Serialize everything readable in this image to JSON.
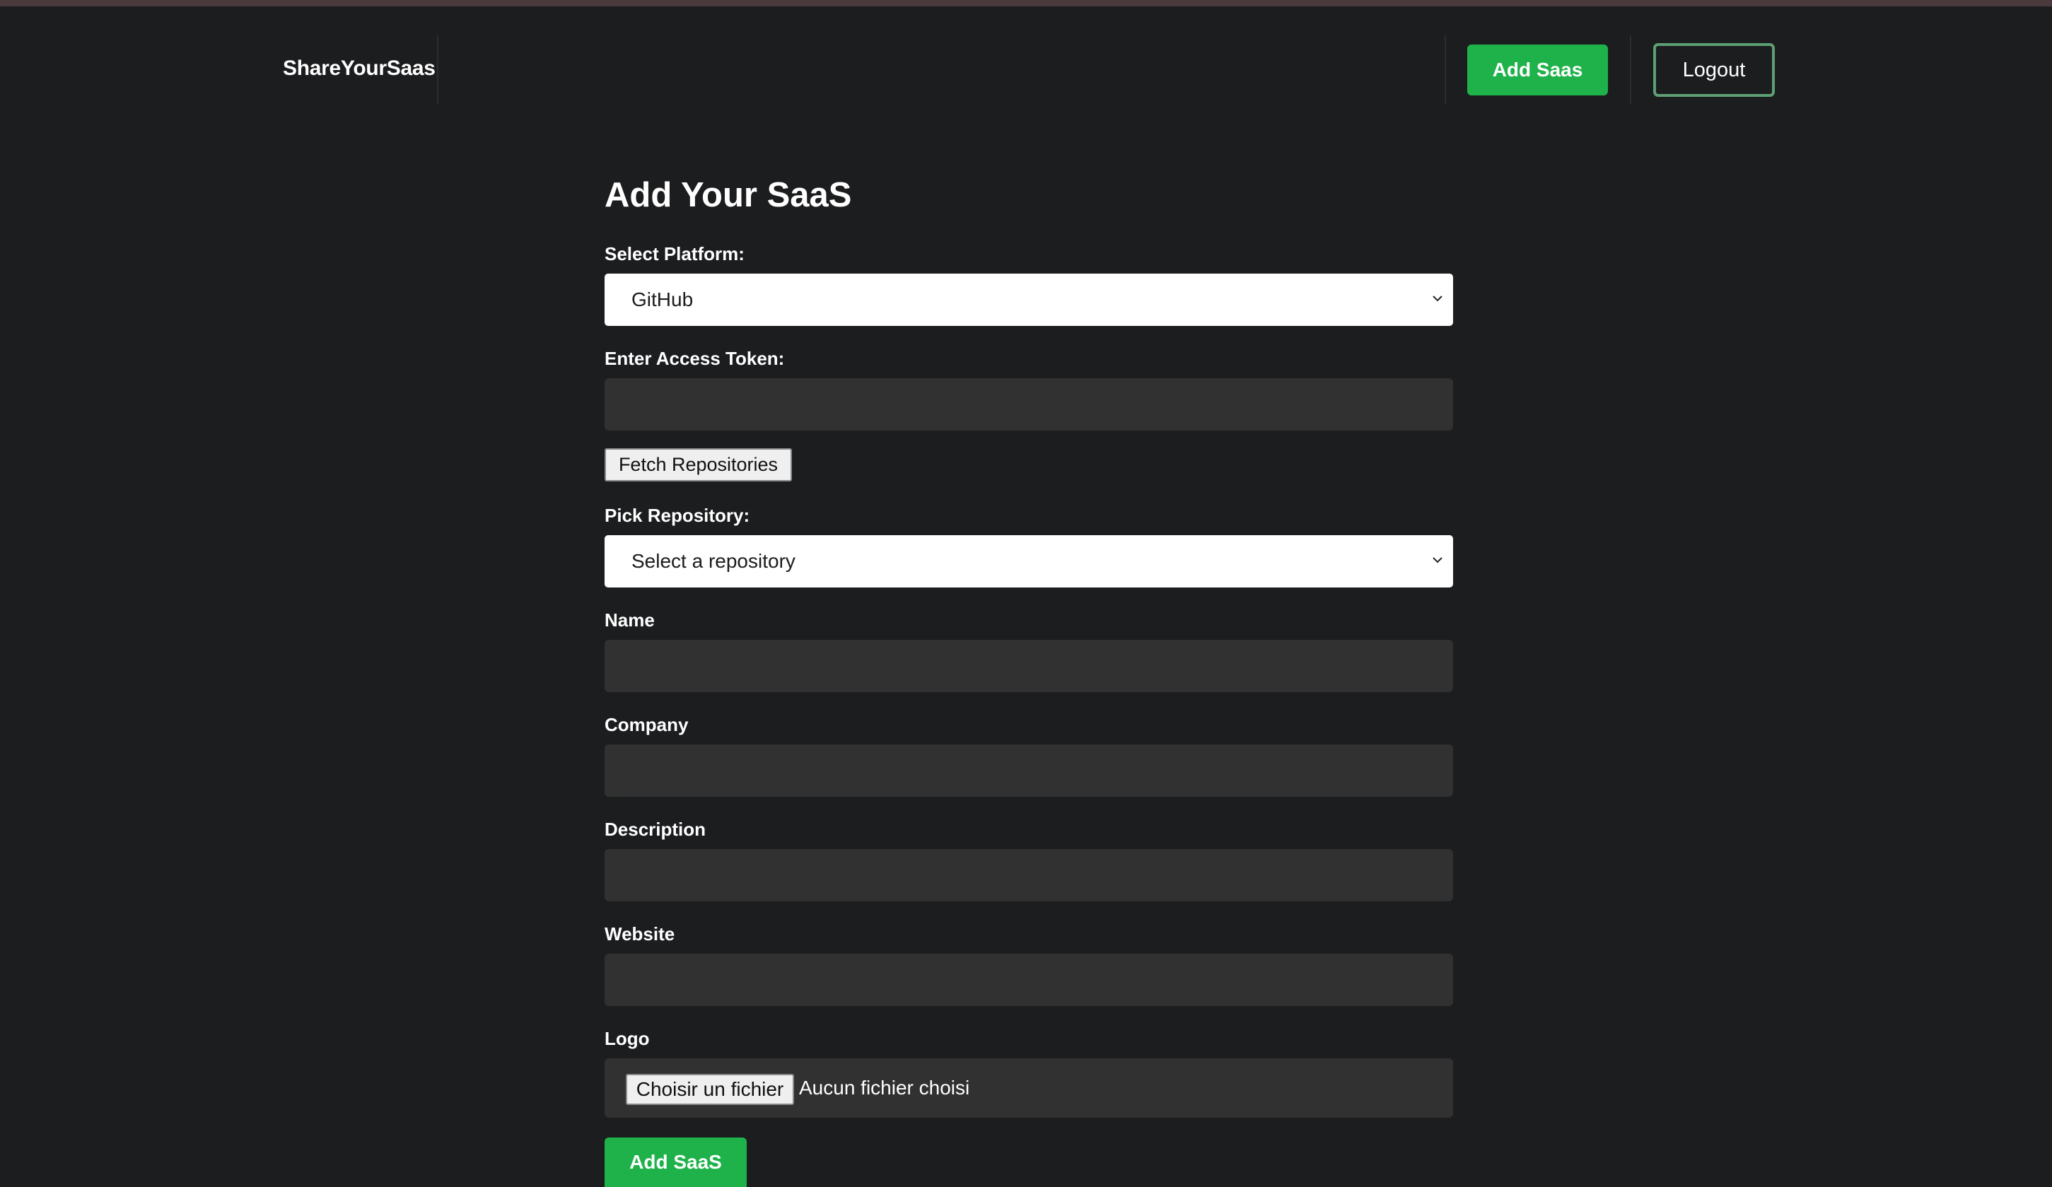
{
  "header": {
    "brand": "ShareYourSaas",
    "add_button": "Add Saas",
    "logout_button": "Logout"
  },
  "form": {
    "title": "Add Your SaaS",
    "platform": {
      "label": "Select Platform:",
      "selected": "GitHub"
    },
    "access_token": {
      "label": "Enter Access Token:",
      "value": ""
    },
    "fetch_button": "Fetch Repositories",
    "repository": {
      "label": "Pick Repository:",
      "selected": "Select a repository"
    },
    "name": {
      "label": "Name",
      "value": ""
    },
    "company": {
      "label": "Company",
      "value": ""
    },
    "description": {
      "label": "Description",
      "value": ""
    },
    "website": {
      "label": "Website",
      "value": ""
    },
    "logo": {
      "label": "Logo",
      "choose_button": "Choisir un fichier",
      "status": "Aucun fichier choisi"
    },
    "submit_button": "Add SaaS"
  },
  "colors": {
    "background": "#1c1d1f",
    "accent_green": "#1fb24a",
    "field_bg": "#313132",
    "logout_border": "#5e9e74"
  },
  "icons": [
    "chevron-down-icon"
  ]
}
